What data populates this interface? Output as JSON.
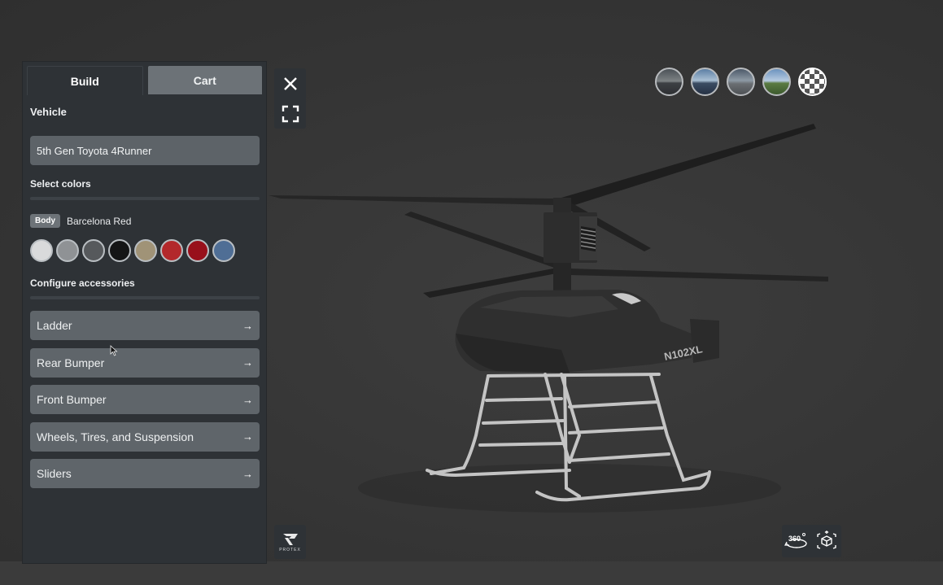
{
  "tabs": [
    {
      "label": "Build",
      "active": true
    },
    {
      "label": "Cart",
      "active": false
    }
  ],
  "vehicle": {
    "section_title": "Vehicle",
    "value": "5th Gen Toyota 4Runner"
  },
  "colors": {
    "section_title": "Select colors",
    "part_badge": "Body",
    "selected_name": "Barcelona Red",
    "swatches": [
      "#d9dadb",
      "#8f9295",
      "#56595c",
      "#141516",
      "#a09377",
      "#b3282b",
      "#98101b",
      "#4f6e95"
    ]
  },
  "accessories": {
    "section_title": "Configure accessories",
    "items": [
      {
        "label": "Ladder"
      },
      {
        "label": "Rear Bumper"
      },
      {
        "label": "Front Bumper"
      },
      {
        "label": "Wheels, Tires, and Suspension"
      },
      {
        "label": "Sliders"
      }
    ]
  },
  "tools": {
    "close_icon": "close-icon",
    "fullscreen_icon": "fullscreen-icon",
    "rotate_label": "360"
  },
  "environments": [
    "env-1",
    "env-2",
    "env-3",
    "env-4",
    "transparent-background"
  ],
  "branding": {
    "logo_text": "PROTEX"
  },
  "model": {
    "tail_number": "N102XL"
  }
}
